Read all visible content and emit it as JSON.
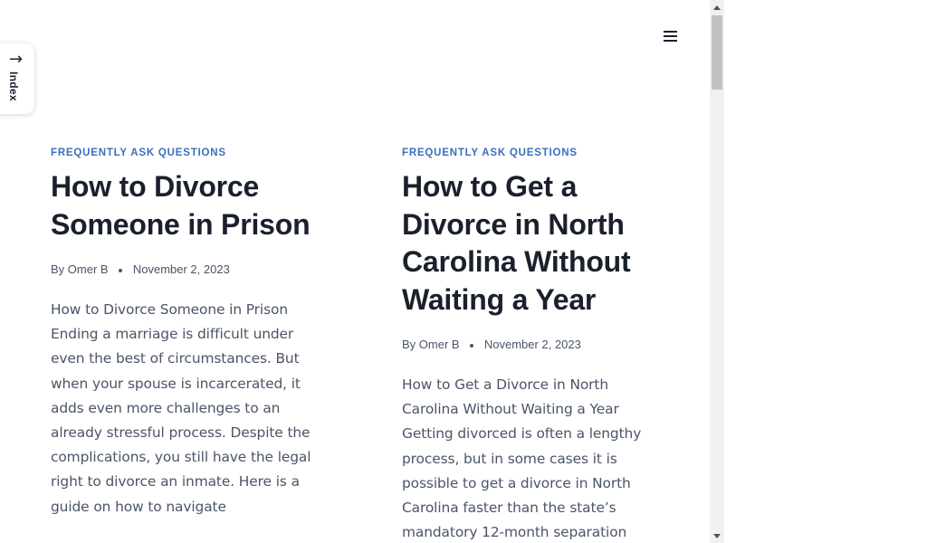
{
  "index_tab": {
    "label": "Index",
    "arrow": "→"
  },
  "menu": {
    "icon": "hamburger-menu-icon"
  },
  "articles": [
    {
      "category": "FREQUENTLY ASK QUESTIONS",
      "title": "How to Divorce Someone in Prison",
      "by_prefix": "By",
      "author": "Omer B",
      "date": "November 2, 2023",
      "excerpt": "How to Divorce Someone in Prison Ending a marriage is difficult under even the best of circumstances. But when your spouse is incarcerated, it adds even more challenges to an already stressful process. Despite the complications, you still have the legal right to divorce an inmate. Here is a guide on how to navigate"
    },
    {
      "category": "FREQUENTLY ASK QUESTIONS",
      "title": "How to Get a Divorce in North Carolina Without Waiting a Year",
      "by_prefix": "By",
      "author": "Omer B",
      "date": "November 2, 2023",
      "excerpt": "How to Get a Divorce in North Carolina Without Waiting a Year Getting divorced is often a lengthy process, but in some cases it is possible to get a divorce in North Carolina faster than the state’s mandatory 12-month separation"
    }
  ],
  "colors": {
    "accent": "#3a6fbf",
    "heading": "#1a202c",
    "text": "#4a5568"
  }
}
